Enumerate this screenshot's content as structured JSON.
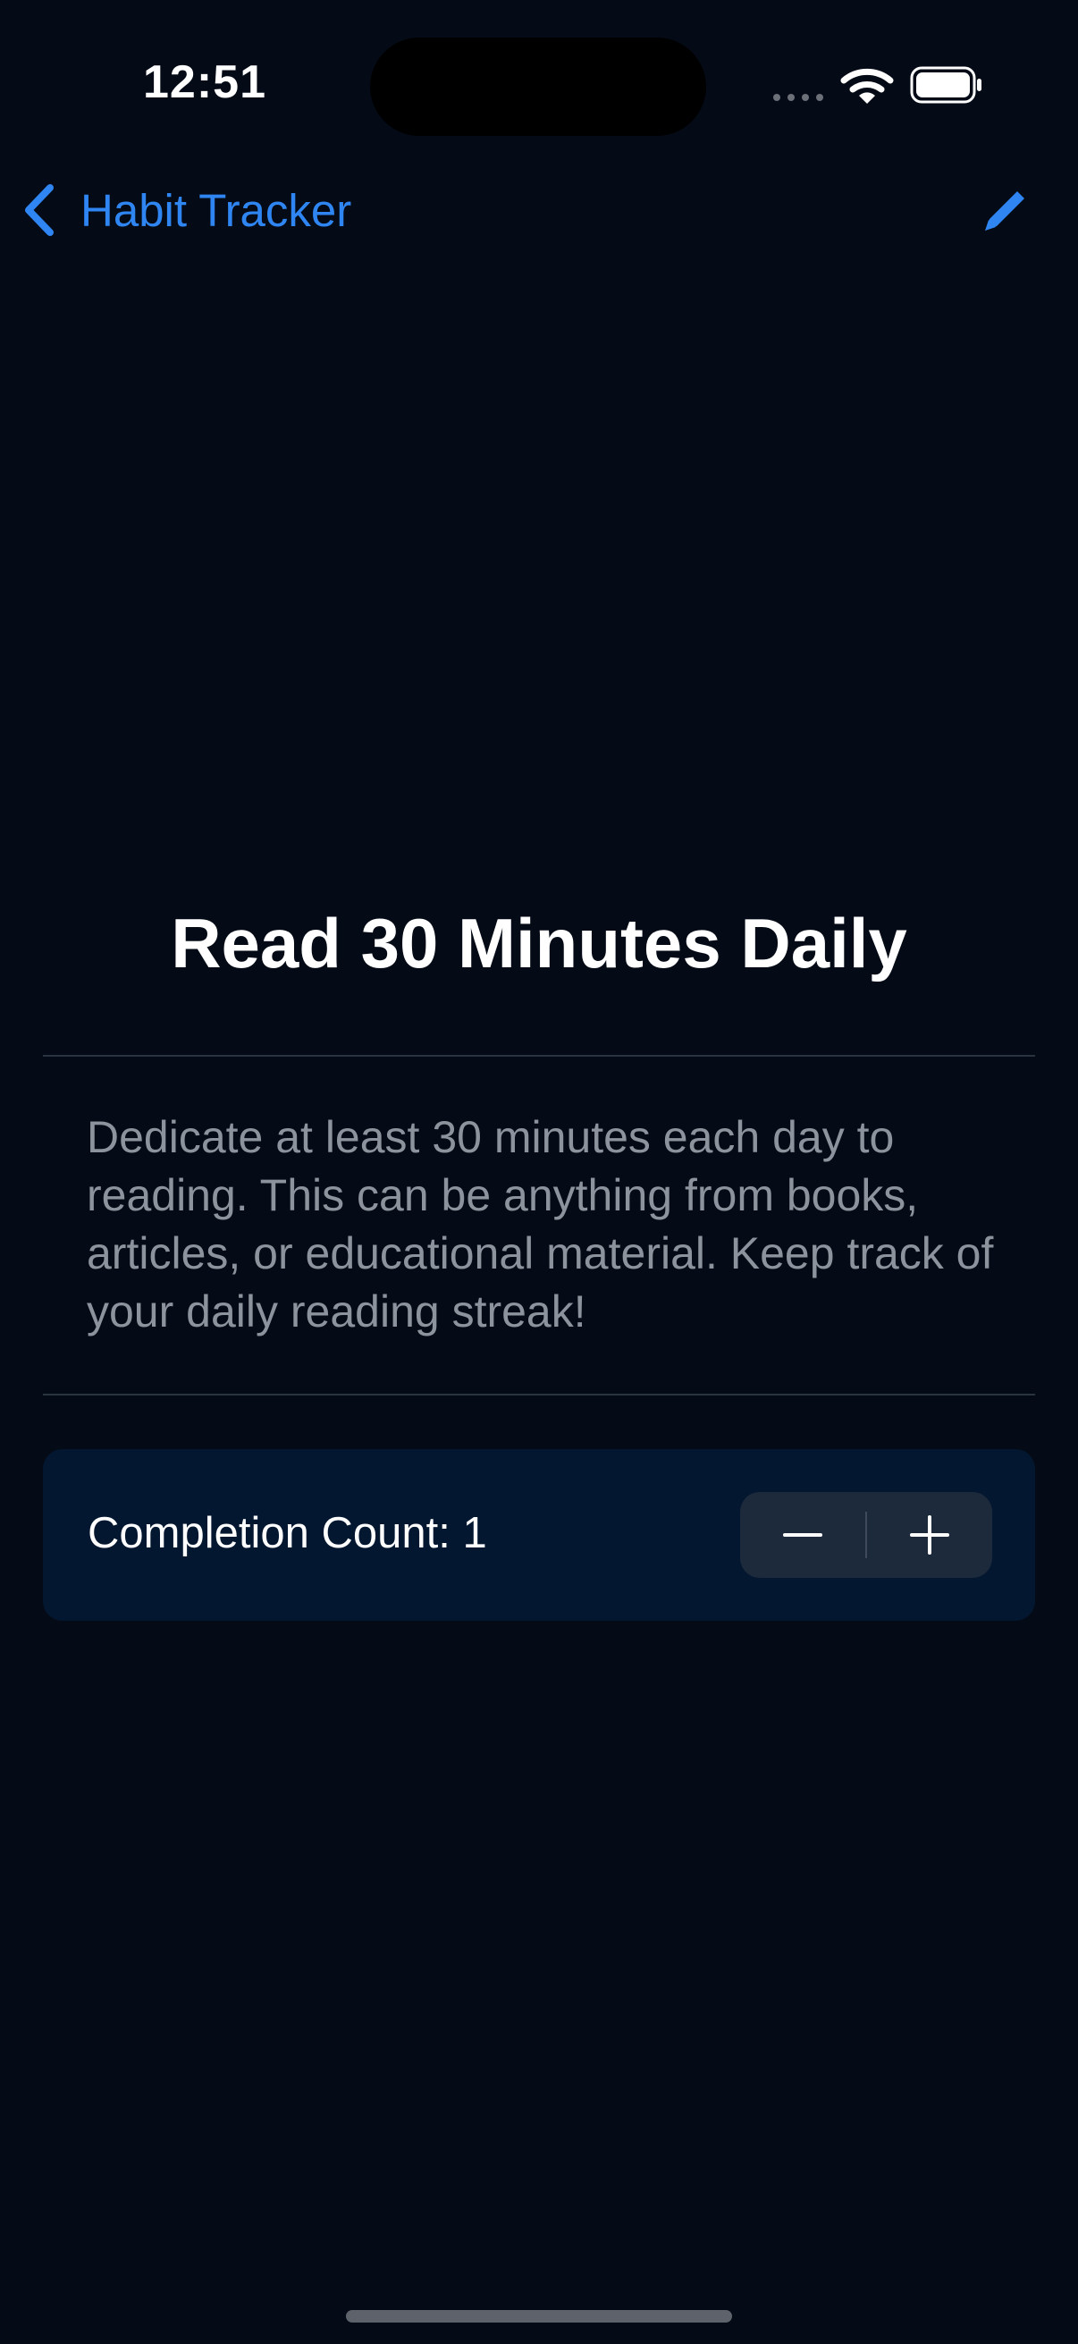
{
  "status_bar": {
    "time": "12:51",
    "icons": [
      "cellular-signal-icon",
      "wifi-icon",
      "battery-icon"
    ]
  },
  "nav": {
    "back_label": "Habit Tracker",
    "back_icon": "chevron-left-icon",
    "edit_icon": "pencil-icon"
  },
  "habit": {
    "title": "Read 30 Minutes Daily",
    "description": "Dedicate at least 30 minutes each day to reading. This can be anything from books, articles, or educational material. Keep track of your daily reading streak!"
  },
  "completion": {
    "label": "Completion Count: 1",
    "decrement_icon": "minus-icon",
    "increment_icon": "plus-icon"
  },
  "colors": {
    "background": "#040B16",
    "accent": "#2F86F3",
    "card": "#031730",
    "secondary_text": "#8D939C"
  }
}
